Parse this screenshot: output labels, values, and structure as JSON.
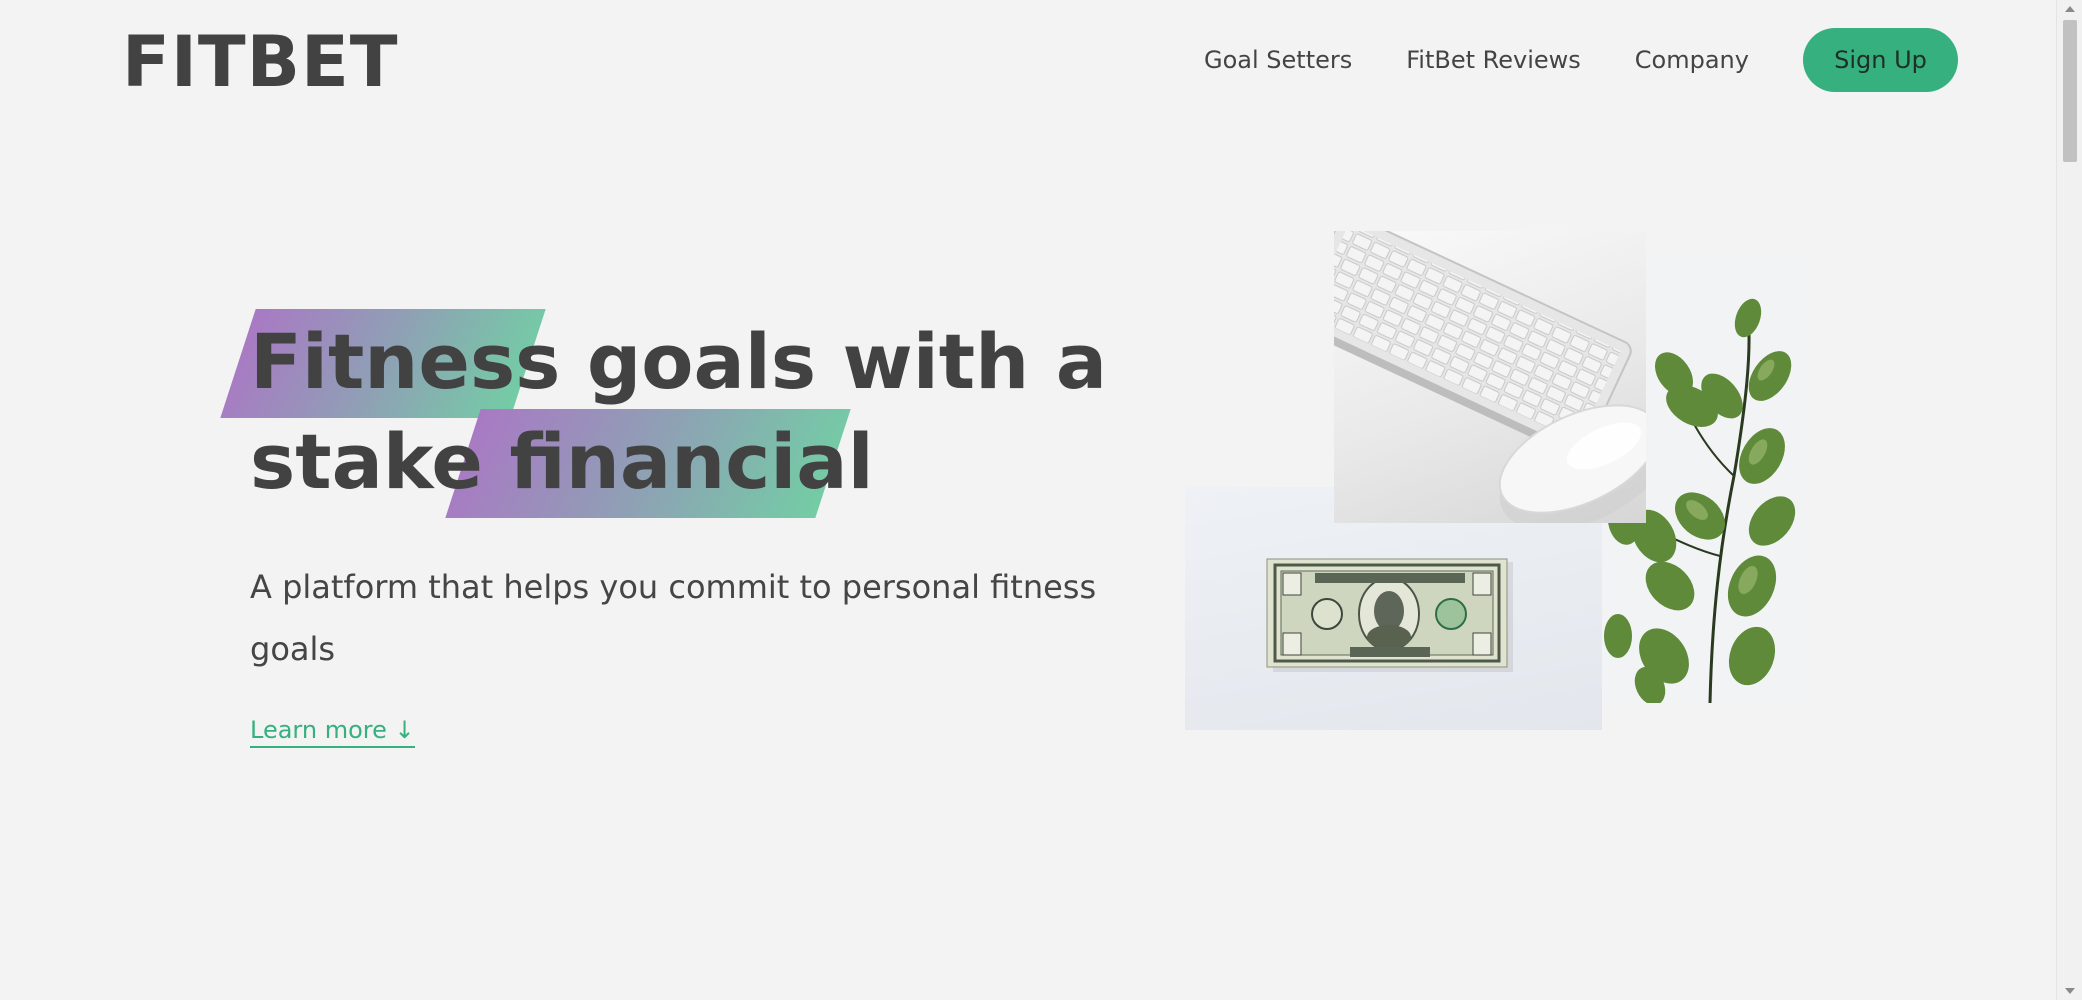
{
  "header": {
    "logo": "FITBET",
    "nav": {
      "goal_setters": "Goal Setters",
      "reviews": "FitBet Reviews",
      "company": "Company",
      "signup": "Sign Up"
    }
  },
  "hero": {
    "headline": {
      "line1_highlight": "Fitness",
      "line1_rest": "goals with a",
      "line2_rest": "stake",
      "line2_highlight": "financial"
    },
    "subtitle": "A platform that helps you commit to personal fitness goals",
    "learn_more": "Learn more ↓"
  },
  "collage": {
    "keyboard_image": "keyboard-and-mouse",
    "money_image": "one-dollar-bill",
    "plant_image": "eucalyptus-plant"
  },
  "colors": {
    "accent": "#36b07f",
    "highlight_gradient_start": "#a979c4",
    "highlight_gradient_end": "#73cda5",
    "text": "#424242",
    "background": "#f3f3f3"
  }
}
